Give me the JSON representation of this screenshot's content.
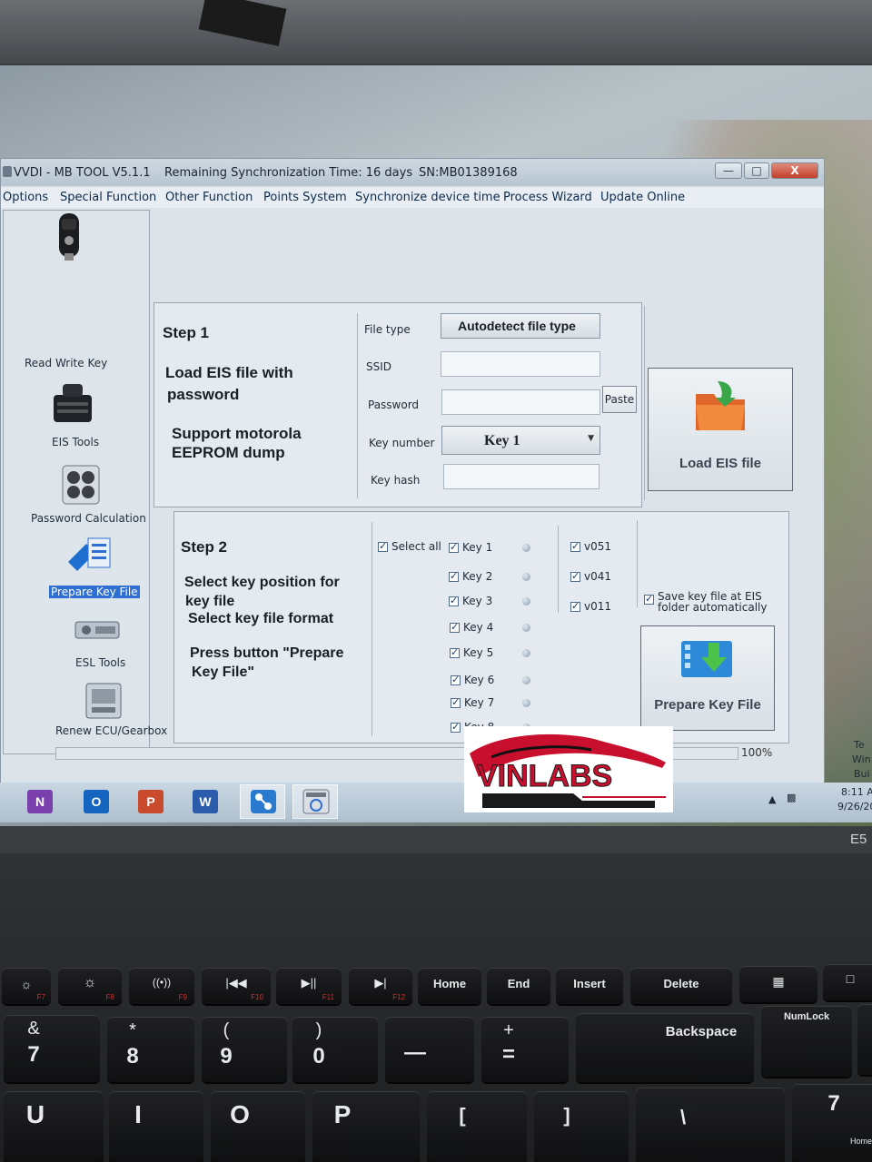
{
  "window": {
    "title": "VVDI - MB TOOL V5.1.1",
    "sync_time": "Remaining Synchronization Time: 16 days",
    "serial": "SN:MB01389168",
    "controls": {
      "minimize": "—",
      "maximize": "□",
      "close": "X"
    }
  },
  "menu": [
    "Options",
    "Special Function",
    "Other Function",
    "Points System",
    "Synchronize device time",
    "Process Wizard",
    "Update Online"
  ],
  "nav": {
    "items": [
      "Read Write Key",
      "EIS Tools",
      "Password Calculation",
      "Prepare Key File",
      "ESL Tools",
      "Renew ECU/Gearbox"
    ],
    "selected": "Prepare Key File"
  },
  "step1": {
    "heading": "Step 1",
    "line1": "Load EIS file with",
    "line2": "password",
    "line3": "Support motorola",
    "line4": "EEPROM dump",
    "labels": {
      "file_type": "File type",
      "ssid": "SSID",
      "password": "Password",
      "key_number": "Key number",
      "key_hash": "Key hash"
    },
    "file_type_value": "Autodetect file type",
    "ssid_value": "",
    "password_value": "",
    "key_number_value": "Key 1",
    "key_hash_value": "",
    "paste_label": "Paste",
    "load_button": "Load EIS file"
  },
  "step2": {
    "heading": "Step 2",
    "line1": "Select key position for",
    "line2": "key file",
    "line3": "Select key file format",
    "line4": "Press button \"Prepare",
    "line5": "Key File\"",
    "select_all": "Select all",
    "keys": [
      "Key 1",
      "Key 2",
      "Key 3",
      "Key 4",
      "Key 5",
      "Key 6",
      "Key 7",
      "Key 8"
    ],
    "formats": [
      "v051",
      "v041",
      "v011"
    ],
    "save_line1": "Save key file at EIS",
    "save_line2": "folder automatically",
    "prepare_button": "Prepare Key File"
  },
  "progress": {
    "value": 1.0,
    "text": "100%"
  },
  "taskbar": {
    "apps": [
      "N",
      "O",
      "P",
      "W"
    ],
    "time": "8:11 A",
    "date": "9/26/20",
    "side_text": [
      "Te",
      "Win",
      "Bui"
    ]
  },
  "watermark": "VINLABS",
  "laptop_model": "E5",
  "keyboard": {
    "row1": [
      "F7",
      "F8",
      "F9",
      "F10",
      "F11",
      "F12",
      "Home",
      "End",
      "Insert",
      "Delete"
    ],
    "numlock": "NumLock",
    "backspace": "Backspace",
    "row2_top": [
      "&",
      "*",
      "(",
      ")",
      "",
      "+"
    ],
    "row2_bottom": [
      "7",
      "8",
      "9",
      "0",
      "—",
      "="
    ],
    "row3": [
      "U",
      "I",
      "O",
      "P",
      "[",
      "]",
      "\\",
      "7"
    ],
    "home_sub": "Home"
  },
  "colors": {
    "selection": "#2f6fd3",
    "window_bg": "#dce4ea",
    "logo_red": "#c8102e"
  }
}
